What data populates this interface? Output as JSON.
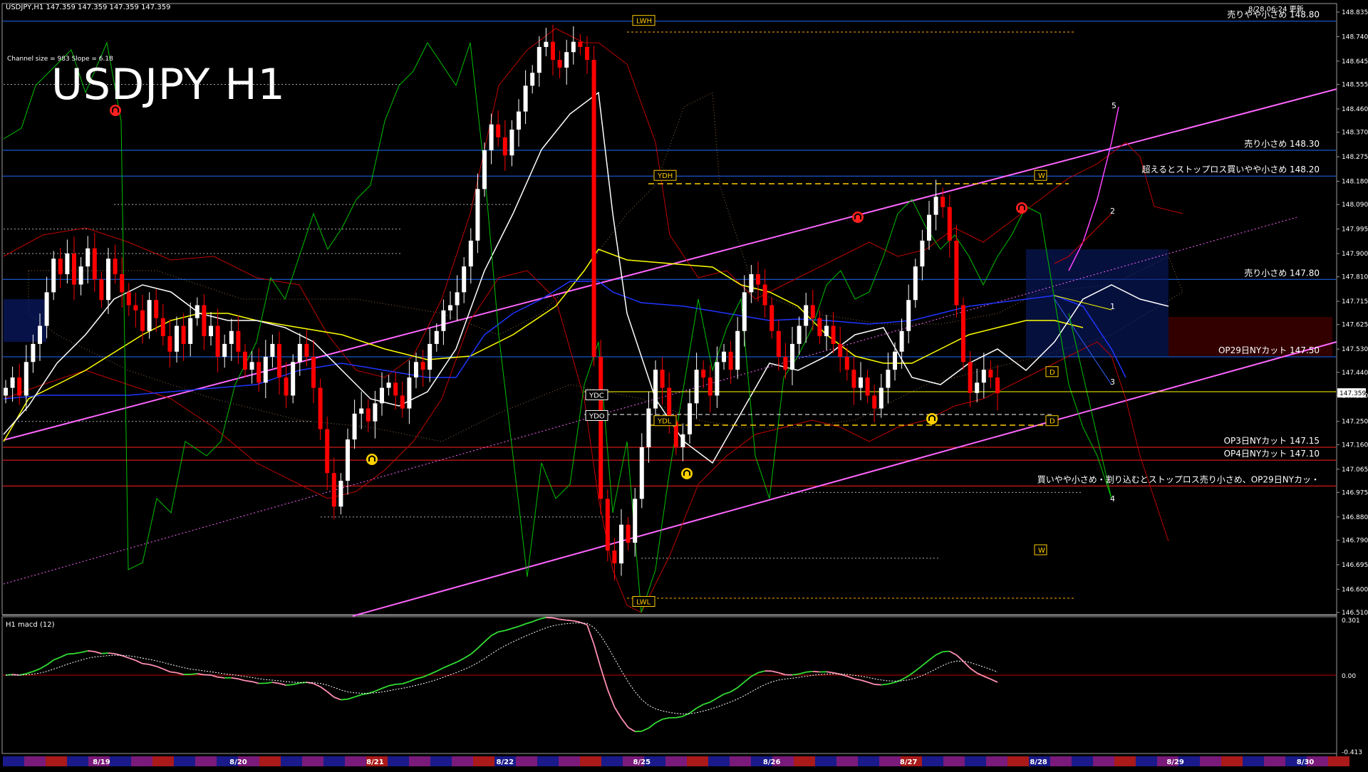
{
  "header": {
    "symbol_line": "USDJPY,H1  147.359 147.359 147.359 147.359",
    "channel_info": "Channel size = 983 Slope = 6.18",
    "big_title": "USDJPY H1",
    "updated": "8/28 06:24 更新"
  },
  "colors": {
    "background": "#000000",
    "bull_candle": "#ffffff",
    "bear_candle": "#ff0000",
    "blue_level": "#1e6cff",
    "red_level": "#ff2020",
    "channel": "#ff66ff",
    "sma_white": "#ffffff",
    "sma_yellow": "#ffff00",
    "sma_blue": "#2040ff",
    "bollinger": "#d00000",
    "green_osc": "#00c800",
    "macd_pos": "#33dd33",
    "macd_neg": "#ff8fb0",
    "orange": "#ff9900",
    "magenta": "#ff44ff"
  },
  "chart_data": {
    "type": "candlestick",
    "symbol": "USDJPY",
    "timeframe": "H1",
    "ylim": [
      146.51,
      148.835
    ],
    "y_ticks": [
      148.835,
      148.74,
      148.645,
      148.555,
      148.46,
      148.37,
      148.275,
      148.18,
      148.09,
      147.995,
      147.9,
      147.81,
      147.715,
      147.625,
      147.53,
      147.44,
      147.35,
      147.25,
      147.16,
      147.065,
      146.975,
      146.88,
      146.79,
      146.695,
      146.6,
      146.51
    ],
    "current_price": "147.359",
    "x_labels": [
      {
        "label": "8/19",
        "i": 14
      },
      {
        "label": "8/20",
        "i": 34
      },
      {
        "label": "8/21",
        "i": 54
      },
      {
        "label": "8/22",
        "i": 73
      },
      {
        "label": "8/25",
        "i": 93
      },
      {
        "label": "8/26",
        "i": 112
      },
      {
        "label": "8/27",
        "i": 132
      },
      {
        "label": "8/28",
        "i": 151
      },
      {
        "label": "8/29",
        "i": 171
      },
      {
        "label": "8/30",
        "i": 190
      }
    ],
    "candles_close": [
      147.38,
      147.42,
      147.35,
      147.48,
      147.55,
      147.62,
      147.75,
      147.88,
      147.82,
      147.9,
      147.78,
      147.85,
      147.92,
      147.8,
      147.72,
      147.88,
      147.82,
      147.75,
      147.7,
      147.68,
      147.6,
      147.72,
      147.65,
      147.58,
      147.52,
      147.62,
      147.55,
      147.65,
      147.7,
      147.58,
      147.62,
      147.5,
      147.55,
      147.6,
      147.52,
      147.45,
      147.48,
      147.4,
      147.5,
      147.55,
      147.42,
      147.35,
      147.48,
      147.55,
      147.5,
      147.38,
      147.22,
      147.05,
      146.92,
      147.02,
      147.18,
      147.28,
      147.3,
      147.25,
      147.32,
      147.38,
      147.4,
      147.35,
      147.3,
      147.42,
      147.48,
      147.45,
      147.55,
      147.6,
      147.68,
      147.7,
      147.75,
      147.85,
      147.95,
      148.15,
      148.3,
      148.4,
      148.35,
      148.28,
      148.38,
      148.45,
      148.55,
      148.6,
      148.7,
      148.72,
      148.65,
      148.62,
      148.68,
      148.72,
      148.7,
      148.65,
      147.5,
      146.95,
      146.75,
      146.7,
      146.85,
      146.78,
      146.95,
      147.15,
      147.3,
      147.45,
      147.38,
      147.25,
      147.15,
      147.2,
      147.32,
      147.45,
      147.42,
      147.35,
      147.48,
      147.52,
      147.45,
      147.6,
      147.75,
      147.82,
      147.78,
      147.7,
      147.6,
      147.5,
      147.45,
      147.55,
      147.62,
      147.7,
      147.65,
      147.58,
      147.62,
      147.55,
      147.5,
      147.45,
      147.38,
      147.42,
      147.35,
      147.3,
      147.38,
      147.45,
      147.52,
      147.6,
      147.72,
      147.85,
      147.95,
      148.05,
      148.12,
      148.08,
      147.95,
      147.7,
      147.48,
      147.36,
      147.4,
      147.45,
      147.42,
      147.359
    ],
    "price_levels": [
      {
        "price": 148.8,
        "label": "売りやや小さめ 148.80",
        "kind": "sell"
      },
      {
        "price": 148.3,
        "label": "売り小さめ 148.30",
        "kind": "sell"
      },
      {
        "price": 148.2,
        "label": "超えるとストップロス買いやや小さめ 148.20",
        "kind": "buy-stop"
      },
      {
        "price": 147.8,
        "label": "売り小さめ 147.80",
        "kind": "sell"
      },
      {
        "price": 147.5,
        "label": "OP29日NYカット 147.50",
        "kind": "option"
      },
      {
        "price": 147.15,
        "label": "OP3日NYカット 147.15",
        "kind": "option-red"
      },
      {
        "price": 147.1,
        "label": "OP4日NYカット 147.10",
        "kind": "option-red"
      },
      {
        "price": 147.0,
        "label": "買いやや小さめ・割り込むとストップロス売り小さめ、OP29日NYカッ・",
        "kind": "buy"
      }
    ],
    "markers": [
      {
        "label": "LWH",
        "price": 148.8
      },
      {
        "label": "YDH",
        "price": 148.2
      },
      {
        "label": "YDC",
        "price": 147.35
      },
      {
        "label": "YDO",
        "price": 147.27
      },
      {
        "label": "YDL",
        "price": 147.25
      },
      {
        "label": "LWL",
        "price": 146.55
      },
      {
        "label": "W",
        "price": 148.2
      },
      {
        "label": "W",
        "price": 146.75
      },
      {
        "label": "D",
        "price": 147.44
      },
      {
        "label": "D",
        "price": 147.25
      }
    ],
    "projection_labels": [
      "5",
      "2",
      "1",
      "3",
      "4"
    ],
    "macd": {
      "label": "H1  macd (12)",
      "ticks": [
        "0.301",
        "0.00",
        "-0.413"
      ],
      "ylim": [
        -0.413,
        0.301
      ]
    }
  }
}
